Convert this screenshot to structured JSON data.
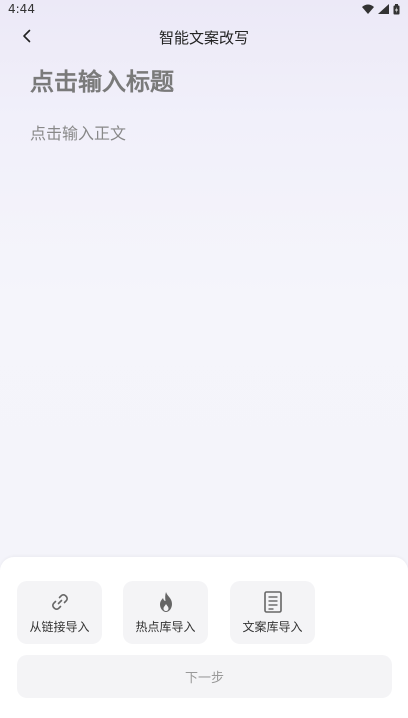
{
  "status_bar": {
    "time": "4:44",
    "icons": [
      "wifi-icon",
      "signal-icon",
      "battery-icon"
    ]
  },
  "nav": {
    "back_icon": "chevron-left-icon",
    "title": "智能文案改写"
  },
  "editor": {
    "title_placeholder": "点击输入标题",
    "body_placeholder": "点击输入正文"
  },
  "import_options": [
    {
      "icon": "link-icon",
      "label": "从链接导入"
    },
    {
      "icon": "fire-icon",
      "label": "热点库导入"
    },
    {
      "icon": "document-icon",
      "label": "文案库导入"
    }
  ],
  "next_button": {
    "label": "下一步"
  },
  "colors": {
    "background_top": "#ece9f7",
    "card_bg": "#f4f4f6",
    "placeholder_text": "#7a7a7a"
  }
}
